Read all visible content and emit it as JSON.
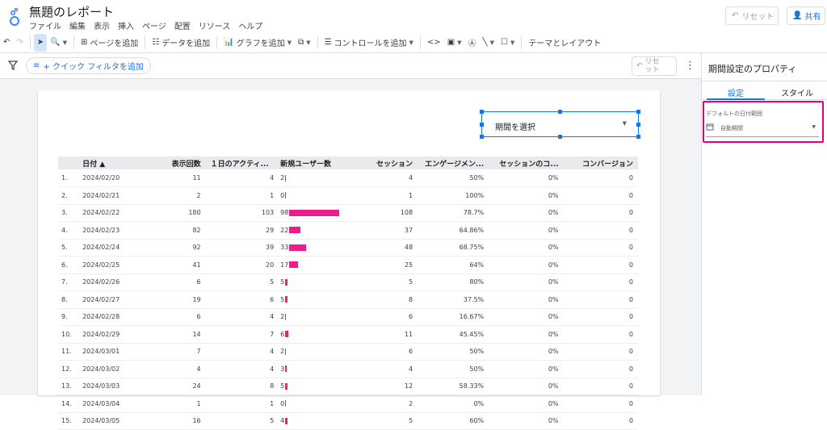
{
  "header": {
    "title": "無題のレポート",
    "menu": [
      "ファイル",
      "編集",
      "表示",
      "挿入",
      "ページ",
      "配置",
      "リソース",
      "ヘルプ"
    ],
    "reset_label": "リセット",
    "share_label": "共有"
  },
  "toolbar": {
    "add_page": "ページを追加",
    "add_data": "データを追加",
    "add_chart": "グラフを追加",
    "add_control": "コントロールを追加",
    "theme_layout": "テーマとレイアウト"
  },
  "filterbar": {
    "quick_filter": "+ クイック フィルタを追加",
    "reset_line1": "リセ",
    "reset_line2": "ット"
  },
  "date_control": {
    "label": "期間を選択"
  },
  "table": {
    "columns": [
      "日付 ▲",
      "表示回数",
      "１日のアクティ...",
      "新規ユーザー数",
      "セッション",
      "エンゲージメン...",
      "セッションのコ...",
      "コンバージョン"
    ],
    "rows": [
      {
        "idx": "1.",
        "date": "2024/02/20",
        "views": "11",
        "active": "4",
        "new_users": "2",
        "new_users_value": 2,
        "sessions": "4",
        "engagement": "50%",
        "conv_rate": "0%",
        "conversions": "0"
      },
      {
        "idx": "2.",
        "date": "2024/02/21",
        "views": "2",
        "active": "1",
        "new_users": "0",
        "new_users_value": 0,
        "sessions": "1",
        "engagement": "100%",
        "conv_rate": "0%",
        "conversions": "0"
      },
      {
        "idx": "3.",
        "date": "2024/02/22",
        "views": "180",
        "active": "103",
        "new_users": "98",
        "new_users_value": 98,
        "sessions": "108",
        "engagement": "78.7%",
        "conv_rate": "0%",
        "conversions": "0"
      },
      {
        "idx": "4.",
        "date": "2024/02/23",
        "views": "82",
        "active": "29",
        "new_users": "22",
        "new_users_value": 22,
        "sessions": "37",
        "engagement": "64.86%",
        "conv_rate": "0%",
        "conversions": "0"
      },
      {
        "idx": "5.",
        "date": "2024/02/24",
        "views": "92",
        "active": "39",
        "new_users": "33",
        "new_users_value": 33,
        "sessions": "48",
        "engagement": "68.75%",
        "conv_rate": "0%",
        "conversions": "0"
      },
      {
        "idx": "6.",
        "date": "2024/02/25",
        "views": "41",
        "active": "20",
        "new_users": "17",
        "new_users_value": 17,
        "sessions": "25",
        "engagement": "64%",
        "conv_rate": "0%",
        "conversions": "0"
      },
      {
        "idx": "7.",
        "date": "2024/02/26",
        "views": "6",
        "active": "5",
        "new_users": "5",
        "new_users_value": 5,
        "sessions": "5",
        "engagement": "80%",
        "conv_rate": "0%",
        "conversions": "0"
      },
      {
        "idx": "8.",
        "date": "2024/02/27",
        "views": "19",
        "active": "6",
        "new_users": "5",
        "new_users_value": 5,
        "sessions": "8",
        "engagement": "37.5%",
        "conv_rate": "0%",
        "conversions": "0"
      },
      {
        "idx": "9.",
        "date": "2024/02/28",
        "views": "6",
        "active": "4",
        "new_users": "2",
        "new_users_value": 2,
        "sessions": "6",
        "engagement": "16.67%",
        "conv_rate": "0%",
        "conversions": "0"
      },
      {
        "idx": "10.",
        "date": "2024/02/29",
        "views": "14",
        "active": "7",
        "new_users": "6",
        "new_users_value": 6,
        "sessions": "11",
        "engagement": "45.45%",
        "conv_rate": "0%",
        "conversions": "0"
      },
      {
        "idx": "11.",
        "date": "2024/03/01",
        "views": "7",
        "active": "4",
        "new_users": "2",
        "new_users_value": 2,
        "sessions": "6",
        "engagement": "50%",
        "conv_rate": "0%",
        "conversions": "0"
      },
      {
        "idx": "12.",
        "date": "2024/03/02",
        "views": "4",
        "active": "4",
        "new_users": "3",
        "new_users_value": 3,
        "sessions": "4",
        "engagement": "50%",
        "conv_rate": "0%",
        "conversions": "0"
      },
      {
        "idx": "13.",
        "date": "2024/03/03",
        "views": "24",
        "active": "8",
        "new_users": "5",
        "new_users_value": 5,
        "sessions": "12",
        "engagement": "58.33%",
        "conv_rate": "0%",
        "conversions": "0"
      },
      {
        "idx": "14.",
        "date": "2024/03/04",
        "views": "1",
        "active": "1",
        "new_users": "0",
        "new_users_value": 0,
        "sessions": "2",
        "engagement": "0%",
        "conv_rate": "0%",
        "conversions": "0"
      },
      {
        "idx": "15.",
        "date": "2024/03/05",
        "views": "16",
        "active": "5",
        "new_users": "4",
        "new_users_value": 4,
        "sessions": "5",
        "engagement": "60%",
        "conv_rate": "0%",
        "conversions": "0"
      }
    ],
    "bar_color": "#e91e8c"
  },
  "panel": {
    "title": "期間設定のプロパティ",
    "tab_setup": "設定",
    "tab_style": "スタイル",
    "default_range_label": "デフォルトの日付範囲",
    "default_range_value": "自動期間",
    "highlight_color": "#e5007e"
  }
}
